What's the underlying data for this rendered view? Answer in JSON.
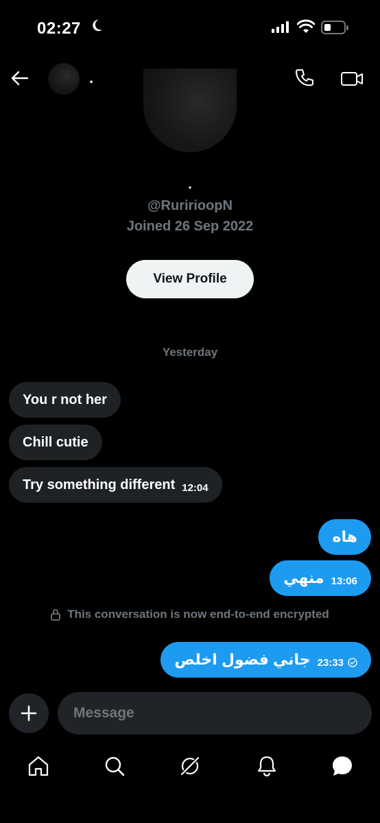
{
  "status_bar": {
    "time": "02:27"
  },
  "header": {
    "name": "."
  },
  "profile": {
    "name": ".",
    "handle": "@RuririoopN",
    "joined": "Joined 26 Sep 2022",
    "view_profile_label": "View Profile"
  },
  "day_separator": "Yesterday",
  "messages": [
    {
      "direction": "incoming",
      "text": "You r not her",
      "time": ""
    },
    {
      "direction": "incoming",
      "text": "Chill cutie",
      "time": ""
    },
    {
      "direction": "incoming",
      "text": "Try something different",
      "time": "12:04"
    },
    {
      "direction": "outgoing",
      "text": "هاه",
      "time": ""
    },
    {
      "direction": "outgoing",
      "text": "منهي",
      "time": "13:06"
    },
    {
      "direction": "outgoing",
      "text": "جاني فضول اخلص",
      "time": "23:33"
    }
  ],
  "encryption_notice": "This conversation is now end-to-end encrypted",
  "composer": {
    "placeholder": "Message"
  },
  "nav": [
    "home-icon",
    "search-icon",
    "grok-icon",
    "notifications-icon",
    "messages-icon"
  ],
  "colors": {
    "accent": "#1d9bf0",
    "incoming_bubble": "#1f2225",
    "muted": "#6e767d"
  }
}
